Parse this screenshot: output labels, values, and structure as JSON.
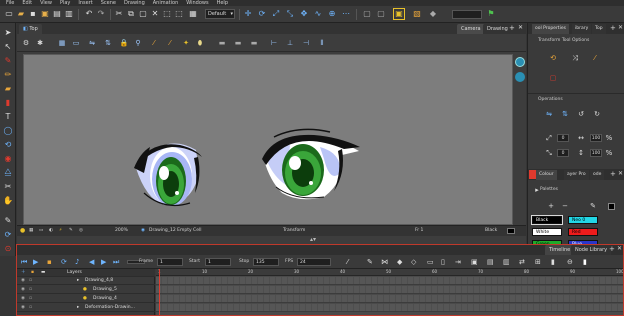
{
  "menu": [
    "File",
    "Edit",
    "View",
    "Play",
    "Insert",
    "Scene",
    "Drawing",
    "Animation",
    "Windows",
    "Help"
  ],
  "toolbar": {
    "preset": "Default"
  },
  "view": {
    "tabs": {
      "top": "Top",
      "camera": "Camera",
      "drawing": "Drawing"
    },
    "status": {
      "zoom": "200%",
      "drawing": "Drawing_12 Empty Cell",
      "mode": "Transform",
      "frame": "Fr 1",
      "color": "Black"
    }
  },
  "right_panel": {
    "tabs": {
      "properties": "ool Properties",
      "library": "ibrary",
      "top": "Top"
    },
    "tool_options": "Transform Tool Options",
    "operations": "Operations",
    "field_x": "0",
    "field_y": "0",
    "field_pct1": "100",
    "field_pct2": "100",
    "color_tabs": {
      "colour": "Colour",
      "layer": "ayer Pro",
      "node": "ode"
    },
    "palettes": "Palettes",
    "swatches": [
      {
        "label": "Black",
        "color": "#000000",
        "text": "#ffffff"
      },
      {
        "label": "Neo 0",
        "color": "#22d7e6",
        "text": "#000000"
      },
      {
        "label": "White",
        "color": "#ffffff",
        "text": "#000000"
      },
      {
        "label": "Red",
        "color": "#ee1c1c",
        "text": "#000000"
      },
      {
        "label": "Green",
        "color": "#1faa2a",
        "text": "#000000"
      },
      {
        "label": "Blue",
        "color": "#2a35c9",
        "text": "#ffffff"
      }
    ]
  },
  "timeline": {
    "tabs": {
      "timeline": "Timeline",
      "node_library": "Node Library"
    },
    "frame_label": "Frame",
    "frame_value": "1",
    "start_label": "Start",
    "start_value": "1",
    "stop_label": "Stop",
    "stop_value": "135",
    "fps_label": "FPS",
    "fps_value": "24",
    "layers_header": "Layers",
    "layers": [
      "Drawing_4,8",
      "Drawing_5",
      "Drawing_4",
      "Deformation-Drawin..."
    ],
    "ruler": [
      "1",
      "10",
      "20",
      "30",
      "40",
      "50",
      "60",
      "70",
      "80",
      "90",
      "100"
    ]
  },
  "colors": {
    "accent": "#e8a53a",
    "canvas": "#7d7d7d",
    "iris": "#3aa63a",
    "eye_shadow": "#8b9cf0",
    "highlight": "#e03a2e"
  }
}
